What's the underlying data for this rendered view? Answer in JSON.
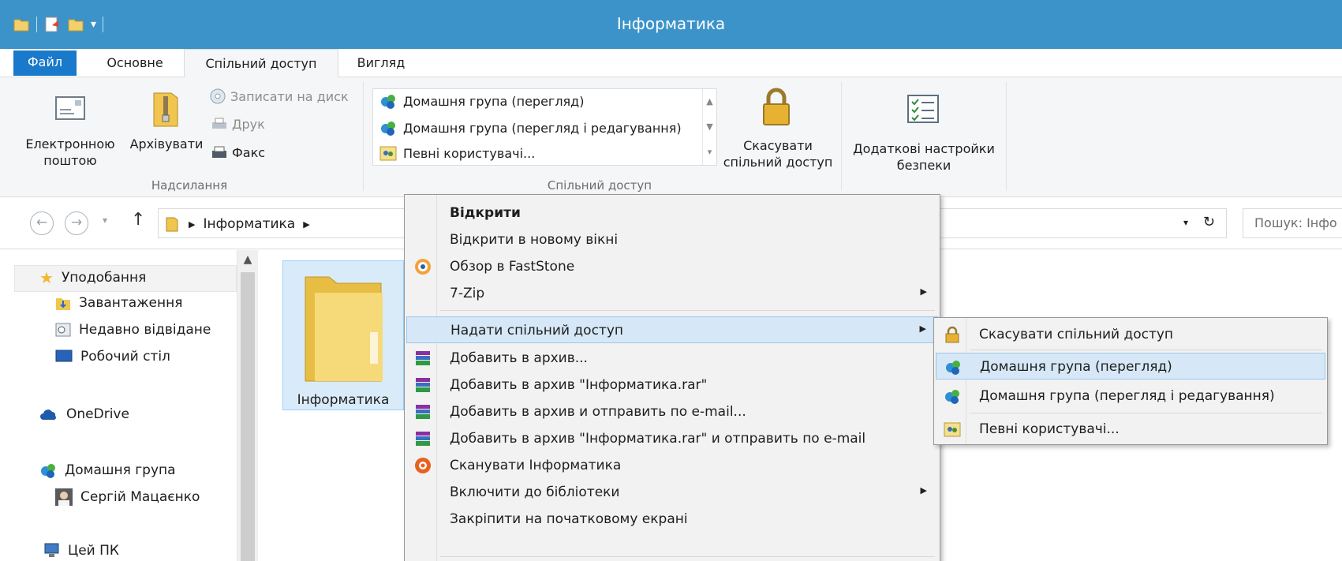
{
  "window": {
    "title": "Інформатика"
  },
  "tabs": [
    {
      "label": "Файл"
    },
    {
      "label": "Основне"
    },
    {
      "label": "Спільний доступ"
    },
    {
      "label": "Вигляд"
    }
  ],
  "ribbon": {
    "send_group": {
      "label": "Надсилання",
      "email": "Електронною поштою",
      "zip": "Архівувати",
      "burn": "Записати на диск",
      "print": "Друк",
      "fax": "Факс"
    },
    "share_group": {
      "label": "Спільний доступ",
      "gallery": [
        "Домашня група (перегляд)",
        "Домашня група (перегляд і редагування)",
        "Певні користувачі..."
      ],
      "stop_sharing": "Скасувати спільний доступ",
      "advanced_security": "Додаткові настройки безпеки"
    }
  },
  "address": {
    "crumb": "Інформатика",
    "search_placeholder": "Пошук: Інфо"
  },
  "nav": {
    "favorites": "Уподобання",
    "downloads": "Завантаження",
    "recent": "Недавно відвідане",
    "desktop": "Робочий стіл",
    "onedrive": "OneDrive",
    "homegroup": "Домашня група",
    "user": "Сергій Мацаєнко",
    "thispc": "Цей ПК"
  },
  "folder": {
    "name": "Інформатика"
  },
  "context_menu": {
    "open": "Відкрити",
    "open_new_window": "Відкрити в новому вікні",
    "faststone": "Обзор в FastStone",
    "zip7": "7-Zip",
    "share": "Надати спільний доступ",
    "add_archive": "Добавить в архив...",
    "add_rar": "Добавить в архив \"Інформатика.rar\"",
    "add_email": "Добавить в архив и отправить по e-mail...",
    "add_rar_email": "Добавить в архив \"Інформатика.rar\" и отправить по e-mail",
    "scan": "Сканувати Інформатика",
    "library": "Включити до бібліотеки",
    "pin_start": "Закріпити на початковому екрані"
  },
  "submenu": {
    "stop": "Скасувати спільний доступ",
    "hg_view": "Домашня група (перегляд)",
    "hg_edit": "Домашня група (перегляд і редагування)",
    "specific": "Певні користувачі..."
  }
}
